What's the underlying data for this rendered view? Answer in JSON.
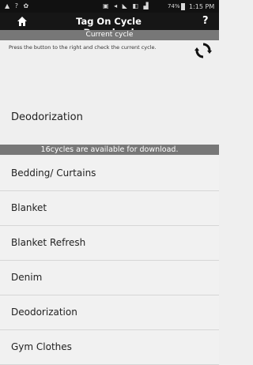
{
  "status_bar": {
    "left_icons": "▲ ? ✿",
    "mid_icons": "▣ ◂ ◣ ◧ ▟",
    "battery_pct": "74%",
    "time": "1:15 PM"
  },
  "app_bar": {
    "title": "Tag On Cycle Download",
    "home_icon": "home-icon",
    "help_label": "?"
  },
  "current_cycle": {
    "header": "Current cycle",
    "instruction": "Press the button to the right and check the current cycle.",
    "value": "Deodorization",
    "refresh_icon": "refresh-icon"
  },
  "available": {
    "header": "16cycles are available for download.",
    "items": [
      "Bedding/ Curtains",
      "Blanket",
      "Blanket Refresh",
      "Denim",
      "Deodorization",
      "Gym Clothes"
    ]
  }
}
